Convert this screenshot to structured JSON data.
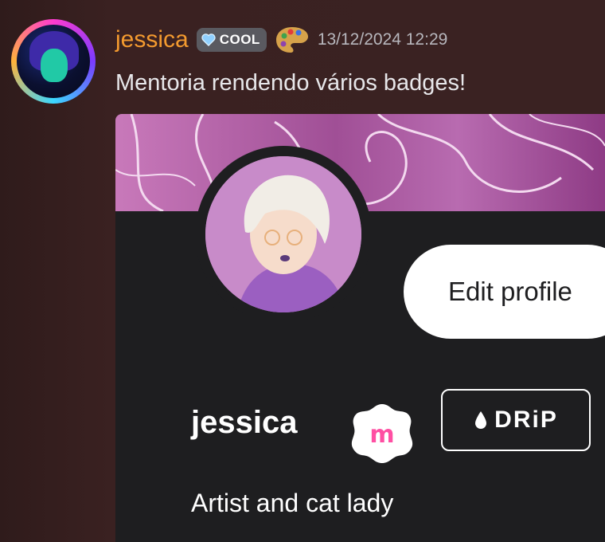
{
  "message": {
    "author": "jessica",
    "badge_text": "COOL",
    "timestamp": "13/12/2024 12:29",
    "text": "Mentoria rendendo vários badges!"
  },
  "profile_card": {
    "edit_button_label": "Edit profile",
    "name": "jessica",
    "badge_m_letter": "m",
    "badge_drip_label": "DRiP",
    "bio": "Artist and cat lady"
  },
  "colors": {
    "username": "#f39a2f",
    "embed_bg": "#1e1e20",
    "badge_pink": "#ff4fa3"
  },
  "icons": [
    "heart-icon",
    "palette-icon",
    "m-badge-icon",
    "drop-icon"
  ]
}
